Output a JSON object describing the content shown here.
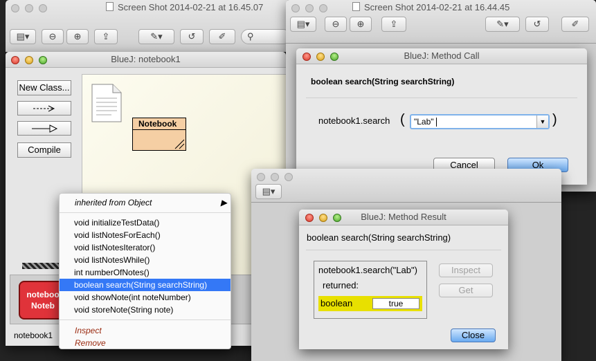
{
  "screenshot_win_1": {
    "title": "Screen Shot 2014-02-21 at 16.45.07"
  },
  "screenshot_win_2": {
    "title": "Screen Shot 2014-02-21 at 16.44.45"
  },
  "bluej_main": {
    "title": "BlueJ:  notebook1",
    "buttons": {
      "new_class": "New Class...",
      "compile": "Compile"
    },
    "class_name": "Notebook",
    "object_bench": {
      "object_line1": "noteboo",
      "object_line2": "Noteb",
      "object_label": "notebook1"
    }
  },
  "context_menu": {
    "inherited": "inherited from Object",
    "methods": [
      "void initializeTestData()",
      "void listNotesForEach()",
      "void listNotesIterator()",
      "void listNotesWhile()",
      "int numberOfNotes()",
      "boolean search(String searchString)",
      "void showNote(int noteNumber)",
      "void storeNote(String note)"
    ],
    "selected_index": 5,
    "actions": {
      "inspect": "Inspect",
      "remove": "Remove"
    }
  },
  "method_call": {
    "title": "BlueJ:  Method Call",
    "signature": "boolean search(String searchString)",
    "call_label": "notebook1.search",
    "open_paren": "(",
    "close_paren": ")",
    "param_value": "\"Lab\"",
    "cancel": "Cancel",
    "ok": "Ok"
  },
  "method_result": {
    "title": "BlueJ:  Method Result",
    "signature": "boolean search(String searchString)",
    "call": "notebook1.search(\"Lab\")",
    "returned": "returned:",
    "type": "boolean",
    "value": "true",
    "inspect": "Inspect",
    "get": "Get",
    "close": "Close"
  },
  "colors": {
    "class_fill": "#f5cfa4",
    "object_fill": "#e0333a",
    "selection": "#3478f6",
    "result_highlight": "#e8e000"
  }
}
